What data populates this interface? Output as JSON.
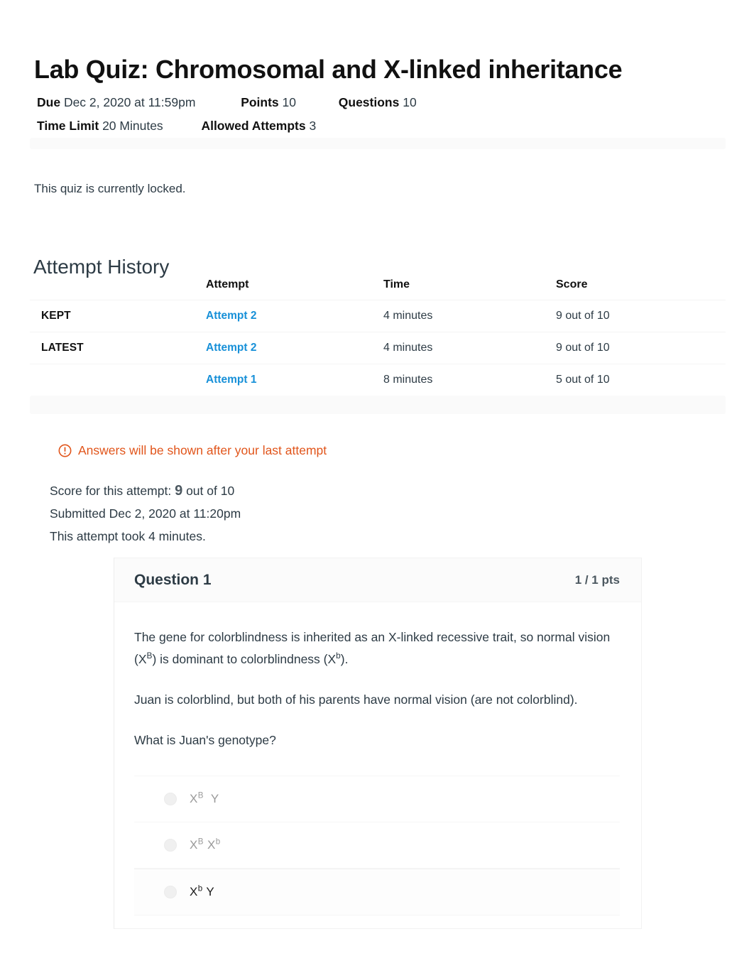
{
  "quiz": {
    "title": "Lab Quiz: Chromosomal and X-linked inheritance",
    "due_label": "Due",
    "due_value": "Dec 2, 2020 at 11:59pm",
    "points_label": "Points",
    "points_value": "10",
    "questions_label": "Questions",
    "questions_value": "10",
    "time_limit_label": "Time Limit",
    "time_limit_value": "20 Minutes",
    "allowed_attempts_label": "Allowed Attempts",
    "allowed_attempts_value": "3",
    "locked_message": "This quiz is currently locked."
  },
  "attempt_history": {
    "heading": "Attempt History",
    "columns": {
      "flag": "",
      "attempt": "Attempt",
      "time": "Time",
      "score": "Score"
    },
    "rows": [
      {
        "flag": "KEPT",
        "attempt": "Attempt 2",
        "time": "4 minutes",
        "score": "9 out of 10"
      },
      {
        "flag": "LATEST",
        "attempt": "Attempt 2",
        "time": "4 minutes",
        "score": "9 out of 10"
      },
      {
        "flag": "",
        "attempt": "Attempt 1",
        "time": "8 minutes",
        "score": "5 out of 10"
      }
    ]
  },
  "notice": {
    "icon": "exclamation-circle-icon",
    "text": "Answers will be shown after your last attempt",
    "color": "#e1551b"
  },
  "attempt_summary": {
    "score_prefix": "Score for this attempt:",
    "score_value": "9",
    "score_suffix": "out of 10",
    "submitted": "Submitted Dec 2, 2020 at 11:20pm",
    "duration": "This attempt took 4 minutes."
  },
  "question": {
    "name": "Question 1",
    "points": "1 / 1 pts",
    "paragraphs": [
      {
        "before": "The gene for colorblindness is inherited as an X-linked recessive trait, so normal vision (X",
        "sup1": "B",
        "middle": ") is dominant to colorblindness (X",
        "sup2": "b",
        "after": ")."
      },
      {
        "text": "Juan is colorblind, but both of his parents have normal vision (are not colorblind)."
      },
      {
        "text": "What is Juan's genotype?"
      }
    ],
    "answers": [
      {
        "base1": "X",
        "sup1": "B",
        "base2": "Y",
        "sup2": "",
        "selected": false
      },
      {
        "base1": "X",
        "sup1": "B",
        "base2": "X",
        "sup2": "b",
        "selected": false
      },
      {
        "base1": "X",
        "sup1": "b",
        "base2": "Y",
        "sup2": "",
        "selected": true
      }
    ]
  },
  "colors": {
    "link_blue": "#1790d8",
    "warning_orange": "#e1551b",
    "text_dark": "#2d3b45"
  }
}
